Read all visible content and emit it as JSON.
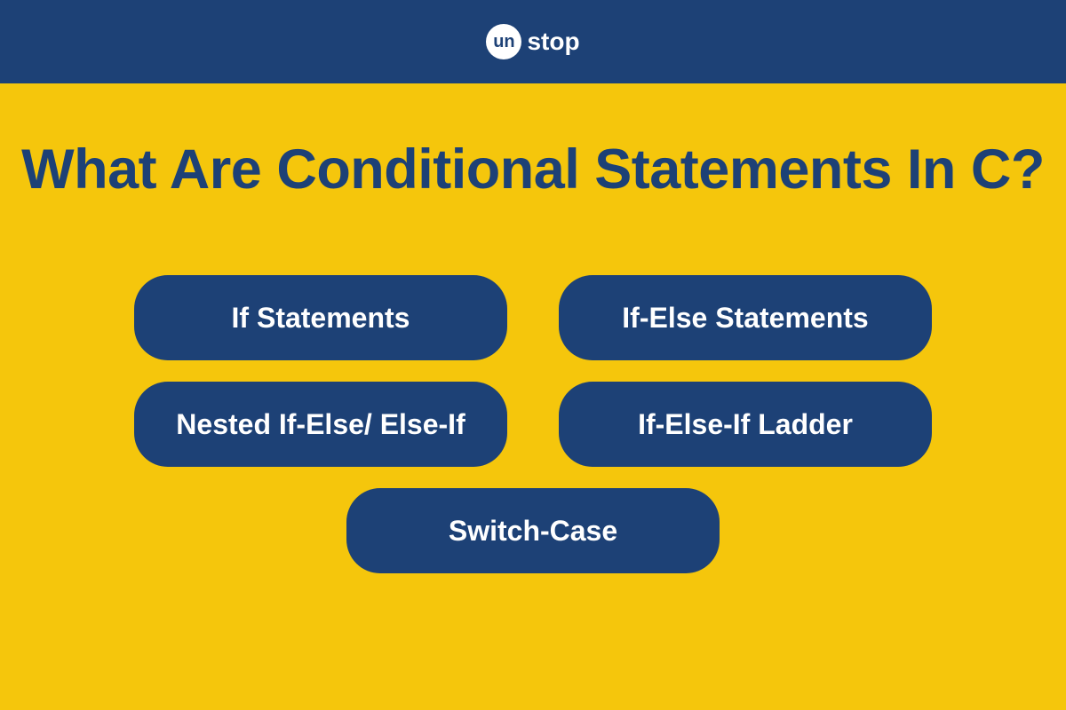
{
  "header": {
    "logo_prefix": "un",
    "logo_suffix": "stop"
  },
  "main": {
    "title": "What Are Conditional Statements In C?"
  },
  "pills": {
    "items": [
      "If Statements",
      "If-Else Statements",
      "Nested If-Else/ Else-If",
      "If-Else-If Ladder",
      "Switch-Case"
    ]
  },
  "colors": {
    "primary": "#1d4176",
    "accent": "#f5c60c",
    "light": "#ffffff"
  }
}
